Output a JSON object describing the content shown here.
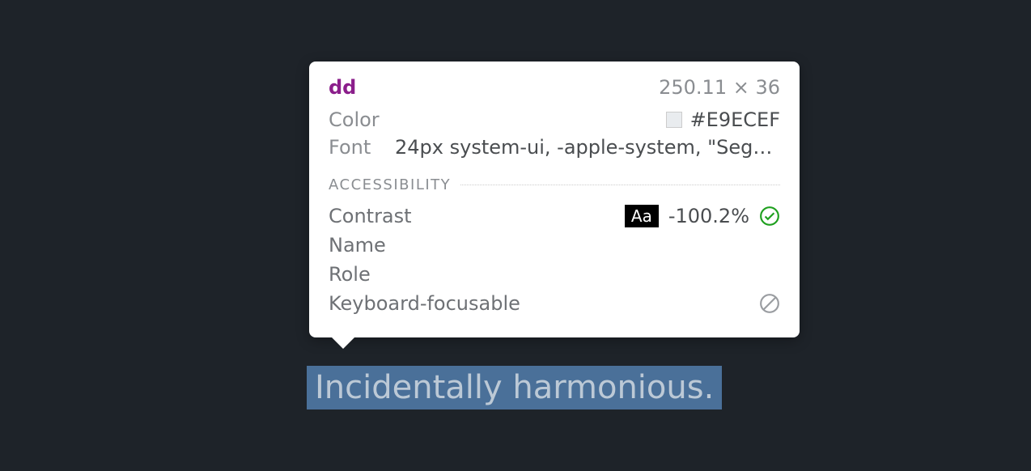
{
  "tooltip": {
    "elementTag": "dd",
    "dimensions": "250.11 × 36",
    "colorLabel": "Color",
    "colorHex": "#E9ECEF",
    "fontLabel": "Font",
    "fontValue": "24px system-ui, -apple-system, \"Segoe…",
    "accessibility": {
      "sectionTitle": "ACCESSIBILITY",
      "contrastLabel": "Contrast",
      "contrastSample": "Aa",
      "contrastValue": "-100.2%",
      "nameLabel": "Name",
      "roleLabel": "Role",
      "keyboardLabel": "Keyboard-focusable"
    }
  },
  "highlightedText": "Incidentally harmonious."
}
